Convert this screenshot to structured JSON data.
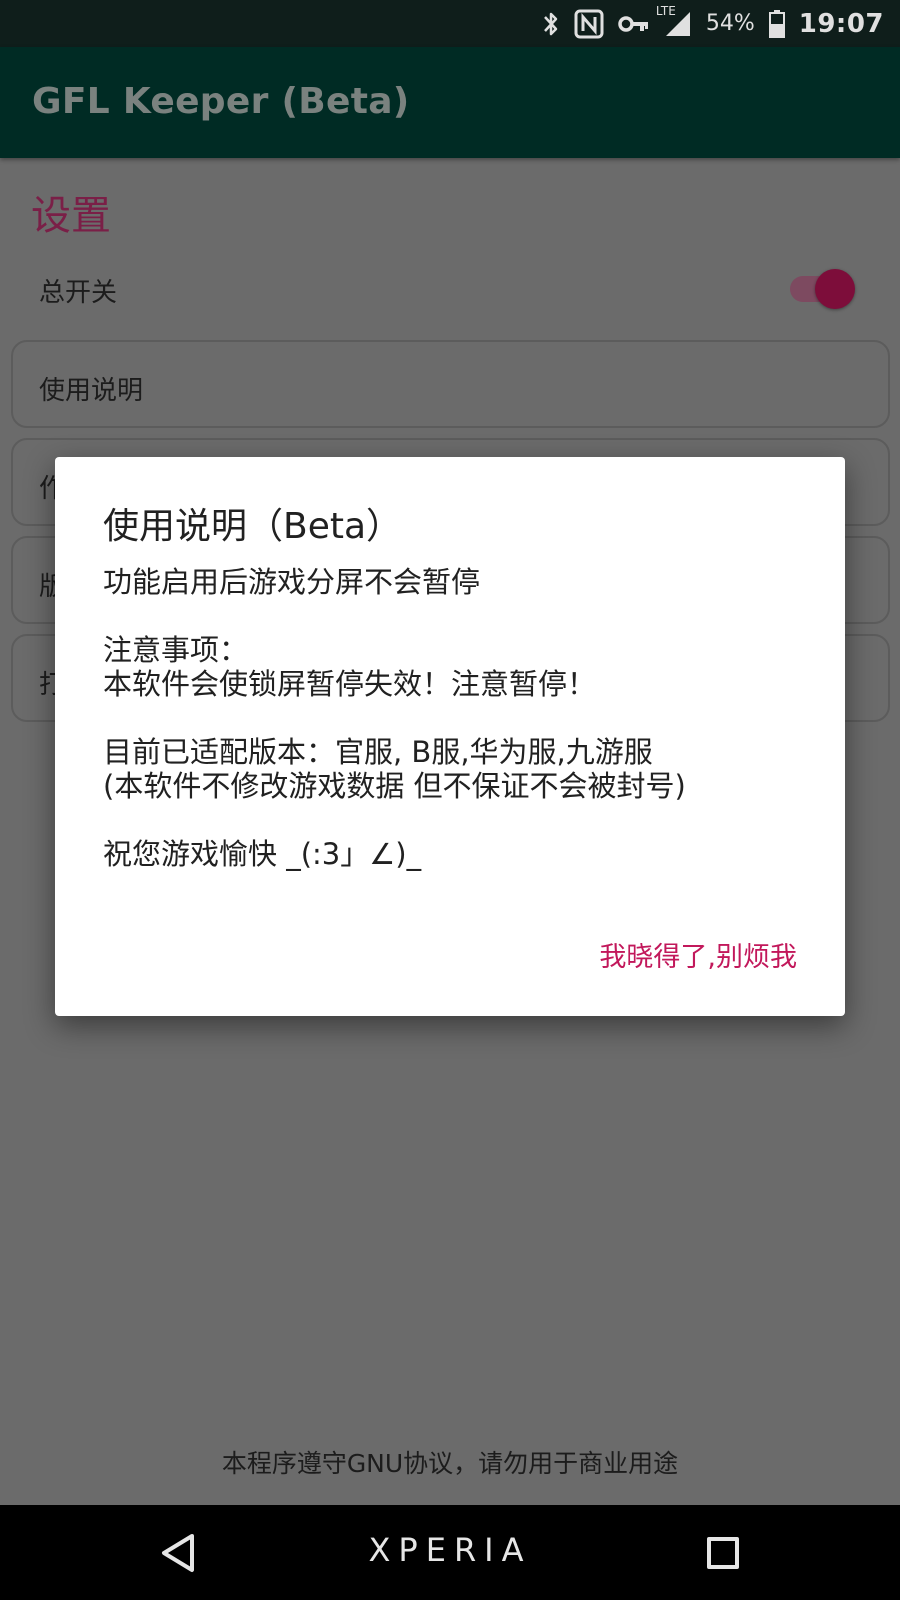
{
  "status_bar": {
    "battery_percent": "54%",
    "time": "19:07",
    "icons": [
      "bluetooth-icon",
      "nfc-icon",
      "vpn-key-icon",
      "lte-signal-icon",
      "battery-icon"
    ],
    "lte_label": "LTE"
  },
  "app_bar": {
    "title": "GFL Keeper (Beta)"
  },
  "settings": {
    "title": "设置",
    "master_switch": {
      "label": "总开关",
      "on": true
    },
    "cards": [
      {
        "label": "使用说明"
      },
      {
        "label": "作"
      },
      {
        "label": "版"
      },
      {
        "label": "打"
      }
    ],
    "footer": "本程序遵守GNU协议，请勿用于商业用途"
  },
  "dialog": {
    "title": "使用说明（Beta）",
    "lines": {
      "l1": "功能启用后游戏分屏不会暂停",
      "l2": "注意事项：",
      "l3": "本软件会使锁屏暂停失效！注意暂停！",
      "l4": "目前已适配版本：官服, B服,华为服,九游服",
      "l5": "(本软件不修改游戏数据 但不保证不会被封号)",
      "l6": "祝您游戏愉快 _(:3」∠)_"
    },
    "dismiss_button": "我晓得了,别烦我"
  },
  "nav_bar": {
    "brand": "XPERIA"
  },
  "colors": {
    "accent": "#c2185b",
    "app_bar": "#002b24",
    "scrim_background": "#6b6b6b"
  }
}
